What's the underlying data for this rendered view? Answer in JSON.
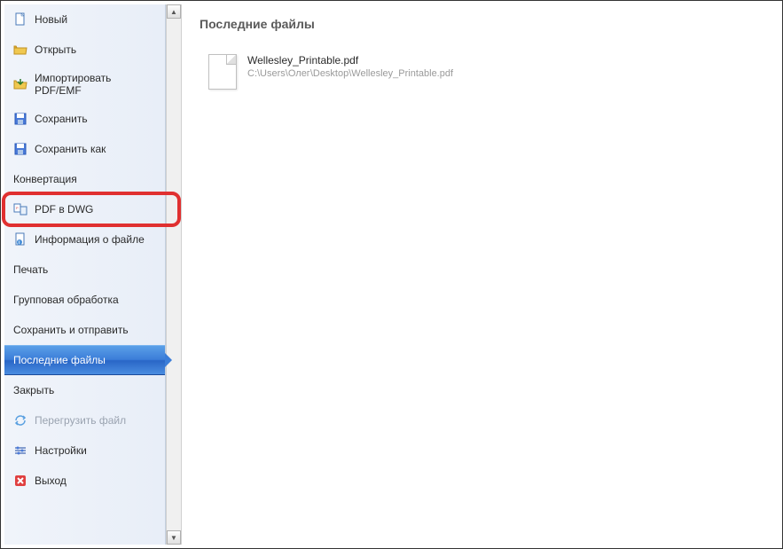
{
  "sidebar": {
    "items": [
      {
        "label": "Новый",
        "icon": "new-file-icon"
      },
      {
        "label": "Открыть",
        "icon": "open-folder-icon"
      },
      {
        "label": "Импортировать PDF/EMF",
        "icon": "import-icon"
      },
      {
        "label": "Сохранить",
        "icon": "save-icon"
      },
      {
        "label": "Сохранить как",
        "icon": "save-as-icon"
      }
    ],
    "section_convert": "Конвертация",
    "convert_items": [
      {
        "label": "PDF в DWG",
        "icon": "pdf-dwg-icon"
      },
      {
        "label": "Информация о файле",
        "icon": "file-info-icon"
      }
    ],
    "section_print": "Печать",
    "section_batch": "Групповая обработка",
    "section_save_send": "Сохранить и отправить",
    "section_recent": "Последние файлы",
    "section_close": "Закрыть",
    "footer_items": [
      {
        "label": "Перегрузить файл",
        "icon": "reload-icon",
        "disabled": true
      },
      {
        "label": "Настройки",
        "icon": "settings-icon"
      },
      {
        "label": "Выход",
        "icon": "exit-icon"
      }
    ]
  },
  "content": {
    "header": "Последние файлы",
    "recent_files": [
      {
        "name": "Wellesley_Printable.pdf",
        "path": "C:\\Users\\Олег\\Desktop\\Wellesley_Printable.pdf"
      }
    ]
  }
}
